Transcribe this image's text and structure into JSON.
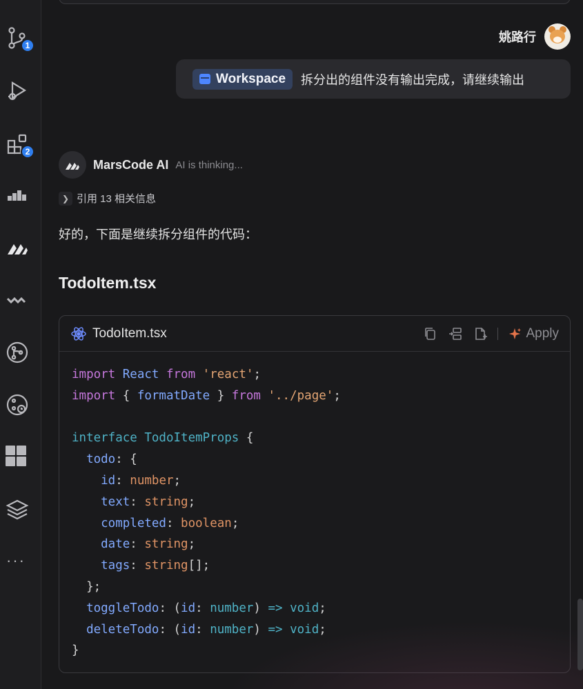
{
  "activity_bar": {
    "items": [
      {
        "icon": "source-control-icon",
        "badge": "1"
      },
      {
        "icon": "run-debug-icon"
      },
      {
        "icon": "extensions-icon",
        "badge": "2"
      },
      {
        "icon": "marscode-blocks-icon"
      },
      {
        "icon": "marscode-ai-icon"
      },
      {
        "icon": "wave-icon"
      },
      {
        "icon": "git-graph-icon"
      },
      {
        "icon": "git-history-icon"
      },
      {
        "icon": "grid-icon"
      },
      {
        "icon": "layers-icon"
      },
      {
        "icon": "more-icon",
        "label": "···"
      }
    ]
  },
  "user_message": {
    "user_name": "姚路行",
    "chip_label": "Workspace",
    "text": "拆分出的组件没有输出完成，请继续输出"
  },
  "ai_message": {
    "name": "MarsCode AI",
    "status": "AI is thinking...",
    "reference_label": "引用 13 相关信息",
    "answer_text": "好的，下面是继续拆分组件的代码：",
    "file_heading": "TodoItem.tsx"
  },
  "code_block": {
    "file_name": "TodoItem.tsx",
    "apply_label": "Apply",
    "lines": [
      [
        {
          "t": "import",
          "c": "kw"
        },
        {
          "t": " React ",
          "c": "id"
        },
        {
          "t": "from",
          "c": "kw"
        },
        {
          "t": " 'react'",
          "c": "str"
        },
        {
          "t": ";",
          "c": "punc"
        }
      ],
      [
        {
          "t": "import",
          "c": "kw"
        },
        {
          "t": " { ",
          "c": "punc"
        },
        {
          "t": "formatDate",
          "c": "id"
        },
        {
          "t": " } ",
          "c": "punc"
        },
        {
          "t": "from",
          "c": "kw"
        },
        {
          "t": " '../page'",
          "c": "str"
        },
        {
          "t": ";",
          "c": "punc"
        }
      ],
      [],
      [
        {
          "t": "interface",
          "c": "ifn"
        },
        {
          "t": " TodoItemProps",
          "c": "ifn"
        },
        {
          "t": " {",
          "c": "punc"
        }
      ],
      [
        {
          "t": "  todo",
          "c": "prop"
        },
        {
          "t": ": {",
          "c": "punc"
        }
      ],
      [
        {
          "t": "    id",
          "c": "prop"
        },
        {
          "t": ": ",
          "c": "punc"
        },
        {
          "t": "number",
          "c": "type"
        },
        {
          "t": ";",
          "c": "punc"
        }
      ],
      [
        {
          "t": "    text",
          "c": "prop"
        },
        {
          "t": ": ",
          "c": "punc"
        },
        {
          "t": "string",
          "c": "type"
        },
        {
          "t": ";",
          "c": "punc"
        }
      ],
      [
        {
          "t": "    completed",
          "c": "prop"
        },
        {
          "t": ": ",
          "c": "punc"
        },
        {
          "t": "boolean",
          "c": "type"
        },
        {
          "t": ";",
          "c": "punc"
        }
      ],
      [
        {
          "t": "    date",
          "c": "prop"
        },
        {
          "t": ": ",
          "c": "punc"
        },
        {
          "t": "string",
          "c": "type"
        },
        {
          "t": ";",
          "c": "punc"
        }
      ],
      [
        {
          "t": "    tags",
          "c": "prop"
        },
        {
          "t": ": ",
          "c": "punc"
        },
        {
          "t": "string",
          "c": "type"
        },
        {
          "t": "[];",
          "c": "punc"
        }
      ],
      [
        {
          "t": "  };",
          "c": "punc"
        }
      ],
      [
        {
          "t": "  toggleTodo",
          "c": "prop"
        },
        {
          "t": ": (",
          "c": "punc"
        },
        {
          "t": "id",
          "c": "prop"
        },
        {
          "t": ": ",
          "c": "punc"
        },
        {
          "t": "number",
          "c": "ifn"
        },
        {
          "t": ") ",
          "c": "punc"
        },
        {
          "t": "=>",
          "c": "arrow"
        },
        {
          "t": " void",
          "c": "ifn"
        },
        {
          "t": ";",
          "c": "punc"
        }
      ],
      [
        {
          "t": "  deleteTodo",
          "c": "prop"
        },
        {
          "t": ": (",
          "c": "punc"
        },
        {
          "t": "id",
          "c": "prop"
        },
        {
          "t": ": ",
          "c": "punc"
        },
        {
          "t": "number",
          "c": "ifn"
        },
        {
          "t": ") ",
          "c": "punc"
        },
        {
          "t": "=>",
          "c": "arrow"
        },
        {
          "t": " void",
          "c": "ifn"
        },
        {
          "t": ";",
          "c": "punc"
        }
      ],
      [
        {
          "t": "}",
          "c": "punc"
        }
      ]
    ]
  },
  "colors": {
    "accent": "#2f7ff0",
    "keyword": "#c678dd",
    "string": "#e5a674",
    "identifier": "#82aaff",
    "interface": "#4fb3c7"
  }
}
